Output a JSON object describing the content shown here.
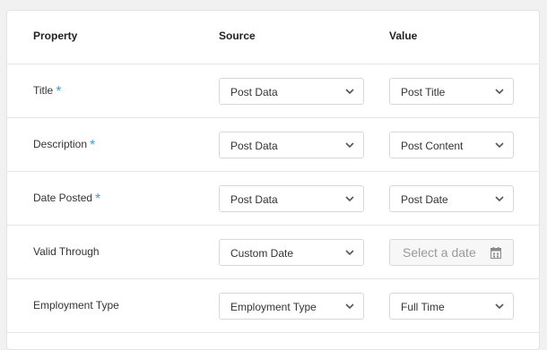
{
  "header": {
    "property": "Property",
    "source": "Source",
    "value": "Value"
  },
  "required_marker": "*",
  "rows": [
    {
      "property": "Title",
      "required": true,
      "source": "Post Data",
      "value": "Post Title"
    },
    {
      "property": "Description",
      "required": true,
      "source": "Post Data",
      "value": "Post Content"
    },
    {
      "property": "Date Posted",
      "required": true,
      "source": "Post Data",
      "value": "Post Date"
    },
    {
      "property": "Valid Through",
      "required": false,
      "source": "Custom Date",
      "value_placeholder": "Select a date"
    },
    {
      "property": "Employment Type",
      "required": false,
      "source": "Employment Type",
      "value": "Full Time"
    }
  ],
  "icons": {
    "dropdown": "chevron-down-icon",
    "date": "calendar-icon"
  },
  "colors": {
    "required_star": "#3aa0d4",
    "placeholder": "#9a9a9a"
  }
}
